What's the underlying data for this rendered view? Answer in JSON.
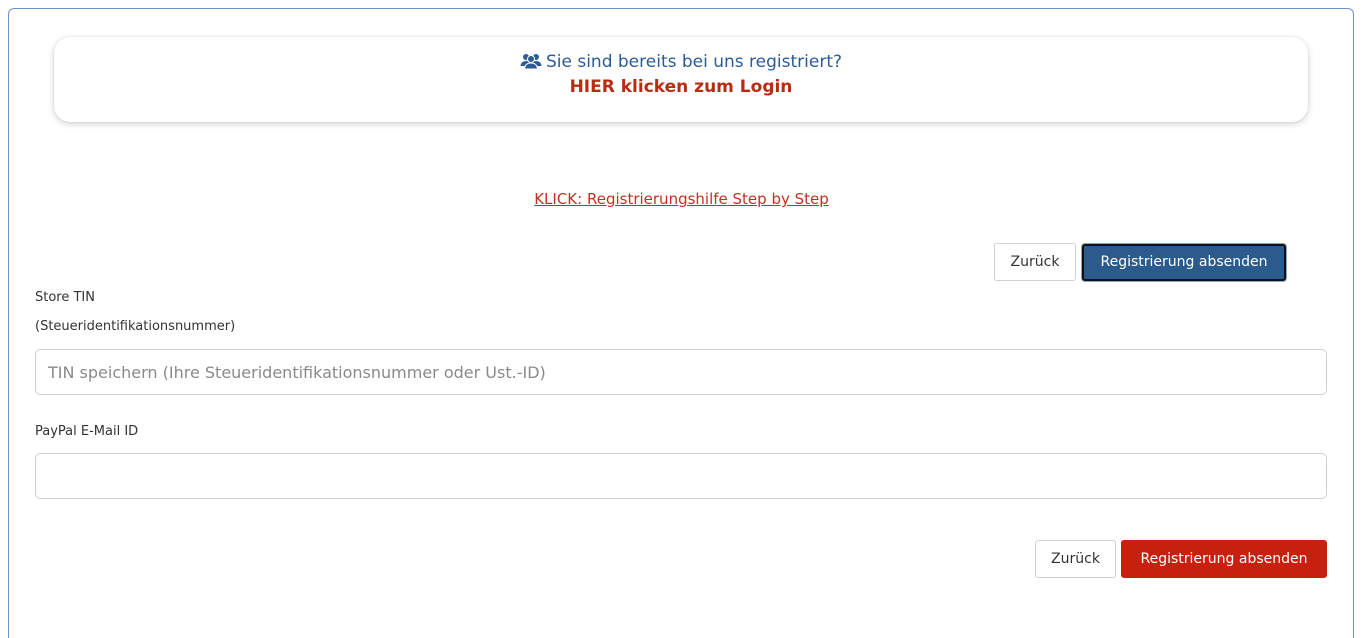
{
  "login_banner": {
    "question": "Sie sind bereits bei uns registriert?",
    "link": "HIER klicken zum Login",
    "icon": "users-icon"
  },
  "help_link": "KLICK: Registrierungshilfe Step by Step",
  "top_actions": {
    "back_label": "Zurück",
    "submit_label": "Registrierung absenden"
  },
  "form": {
    "tin_label": "Store TIN",
    "tin_sublabel": "(Steueridentifikationsnummer)",
    "tin_placeholder": "TIN speichern (Ihre Steueridentifikationsnummer oder Ust.-ID)",
    "tin_value": "",
    "paypal_label": "PayPal E-Mail ID",
    "paypal_placeholder": "",
    "paypal_value": ""
  },
  "bottom_actions": {
    "back_label": "Zurück",
    "submit_label": "Registrierung absenden"
  },
  "colors": {
    "primary_blue": "#2b5b8c",
    "accent_red": "#c8200e",
    "link_red": "#c43021",
    "text_blue": "#2c5b95"
  }
}
